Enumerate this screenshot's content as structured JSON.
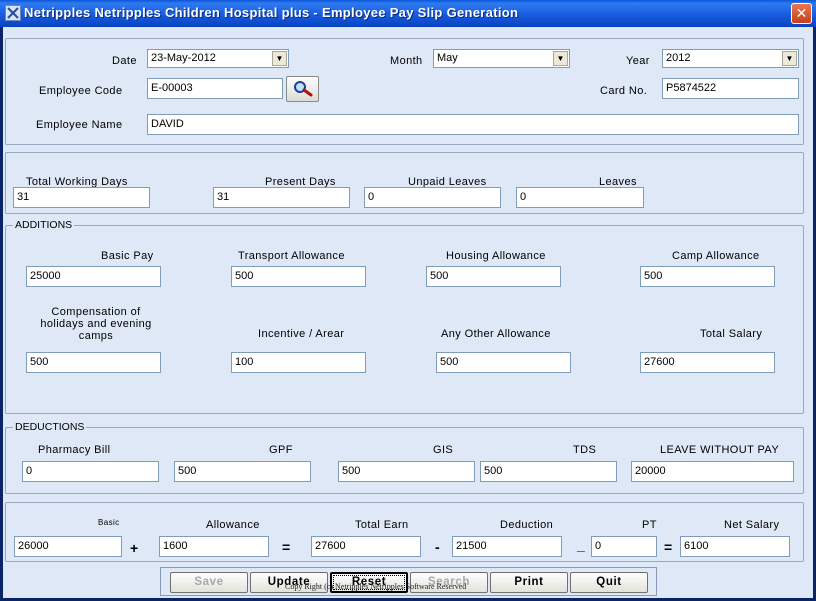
{
  "window": {
    "title": "Netripples Netripples Children Hospital plus - Employee Pay Slip Generation",
    "close_glyph": "✕",
    "app_icon": "app-icon"
  },
  "header": {
    "date_label": "Date",
    "date_value": "23-May-2012",
    "month_label": "Month",
    "month_value": "May",
    "year_label": "Year",
    "year_value": "2012",
    "employee_code_label": "Employee Code",
    "employee_code_value": "E-00003",
    "search_icon": "magnifier-icon",
    "card_no_label": "Card No.",
    "card_no_value": "P5874522",
    "employee_name_label": "Employee Name",
    "employee_name_value": "DAVID"
  },
  "attendance": {
    "total_working_days_label": "Total Working Days",
    "total_working_days_value": "31",
    "present_days_label": "Present Days",
    "present_days_value": "31",
    "unpaid_leaves_label": "Unpaid Leaves",
    "unpaid_leaves_value": "0",
    "leaves_label": "Leaves",
    "leaves_value": "0"
  },
  "additions": {
    "legend": "ADDITIONS",
    "basic_pay_label": "Basic Pay",
    "basic_pay_value": "25000",
    "transport_label": "Transport Allowance",
    "transport_value": "500",
    "housing_label": "Housing Allowance",
    "housing_value": "500",
    "camp_label": "Camp Allowance",
    "camp_value": "500",
    "compensation_label": "Compensation of holidays and evening camps",
    "compensation_value": "500",
    "incentive_label": "Incentive / Arear",
    "incentive_value": "100",
    "other_label": "Any Other Allowance",
    "other_value": "500",
    "total_salary_label": "Total Salary",
    "total_salary_value": "27600"
  },
  "deductions": {
    "legend": "DEDUCTIONS",
    "pharmacy_label": "Pharmacy Bill",
    "pharmacy_value": "0",
    "gpf_label": "GPF",
    "gpf_value": "500",
    "gis_label": "GIS",
    "gis_value": "500",
    "tds_label": "TDS",
    "tds_value": "500",
    "lwp_label": "LEAVE WITHOUT PAY",
    "lwp_value": "20000"
  },
  "summary": {
    "basic_label": "Basic",
    "basic_value": "26000",
    "plus": "+",
    "allowance_label": "Allowance",
    "allowance_value": "1600",
    "equals1": "=",
    "total_earn_label": "Total Earn",
    "total_earn_value": "27600",
    "minus1": "-",
    "deduction_label": "Deduction",
    "deduction_value": "21500",
    "minus2": "_",
    "pt_label": "PT",
    "pt_value": "0",
    "equals2": "=",
    "net_salary_label": "Net Salary",
    "net_salary_value": "6100"
  },
  "buttons": {
    "save": "Save",
    "update": "Update",
    "reset": "Reset",
    "search": "Search",
    "print": "Print",
    "quit": "Quit"
  },
  "footer": {
    "copyright": "Copy Right (c) Netripples Netripples Software Reserved"
  },
  "colors": {
    "titlebar": "#0a55d8",
    "client_bg": "#dfe8f6",
    "panel_border": "#98a8c0"
  }
}
